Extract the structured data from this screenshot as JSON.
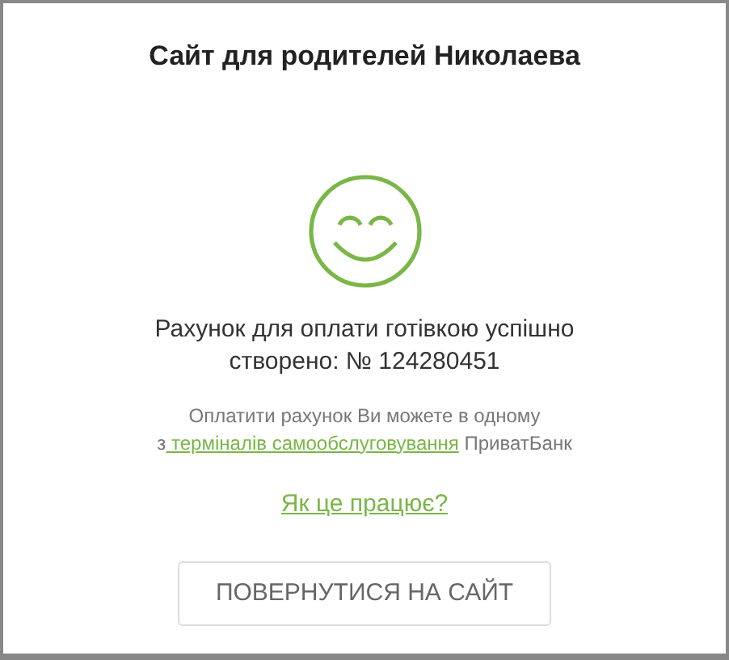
{
  "title": "Сайт для родителей Николаева",
  "message": "Рахунок для оплати готівкою успішно створено: № 124280451",
  "note": {
    "before": "Оплатити рахунок Ви можете в одному з",
    "link": " терміналів самообслуговування",
    "after": " ПриватБанк"
  },
  "help_link": "Як це працює?",
  "button": "ПОВЕРНУТИСЯ НА САЙТ"
}
